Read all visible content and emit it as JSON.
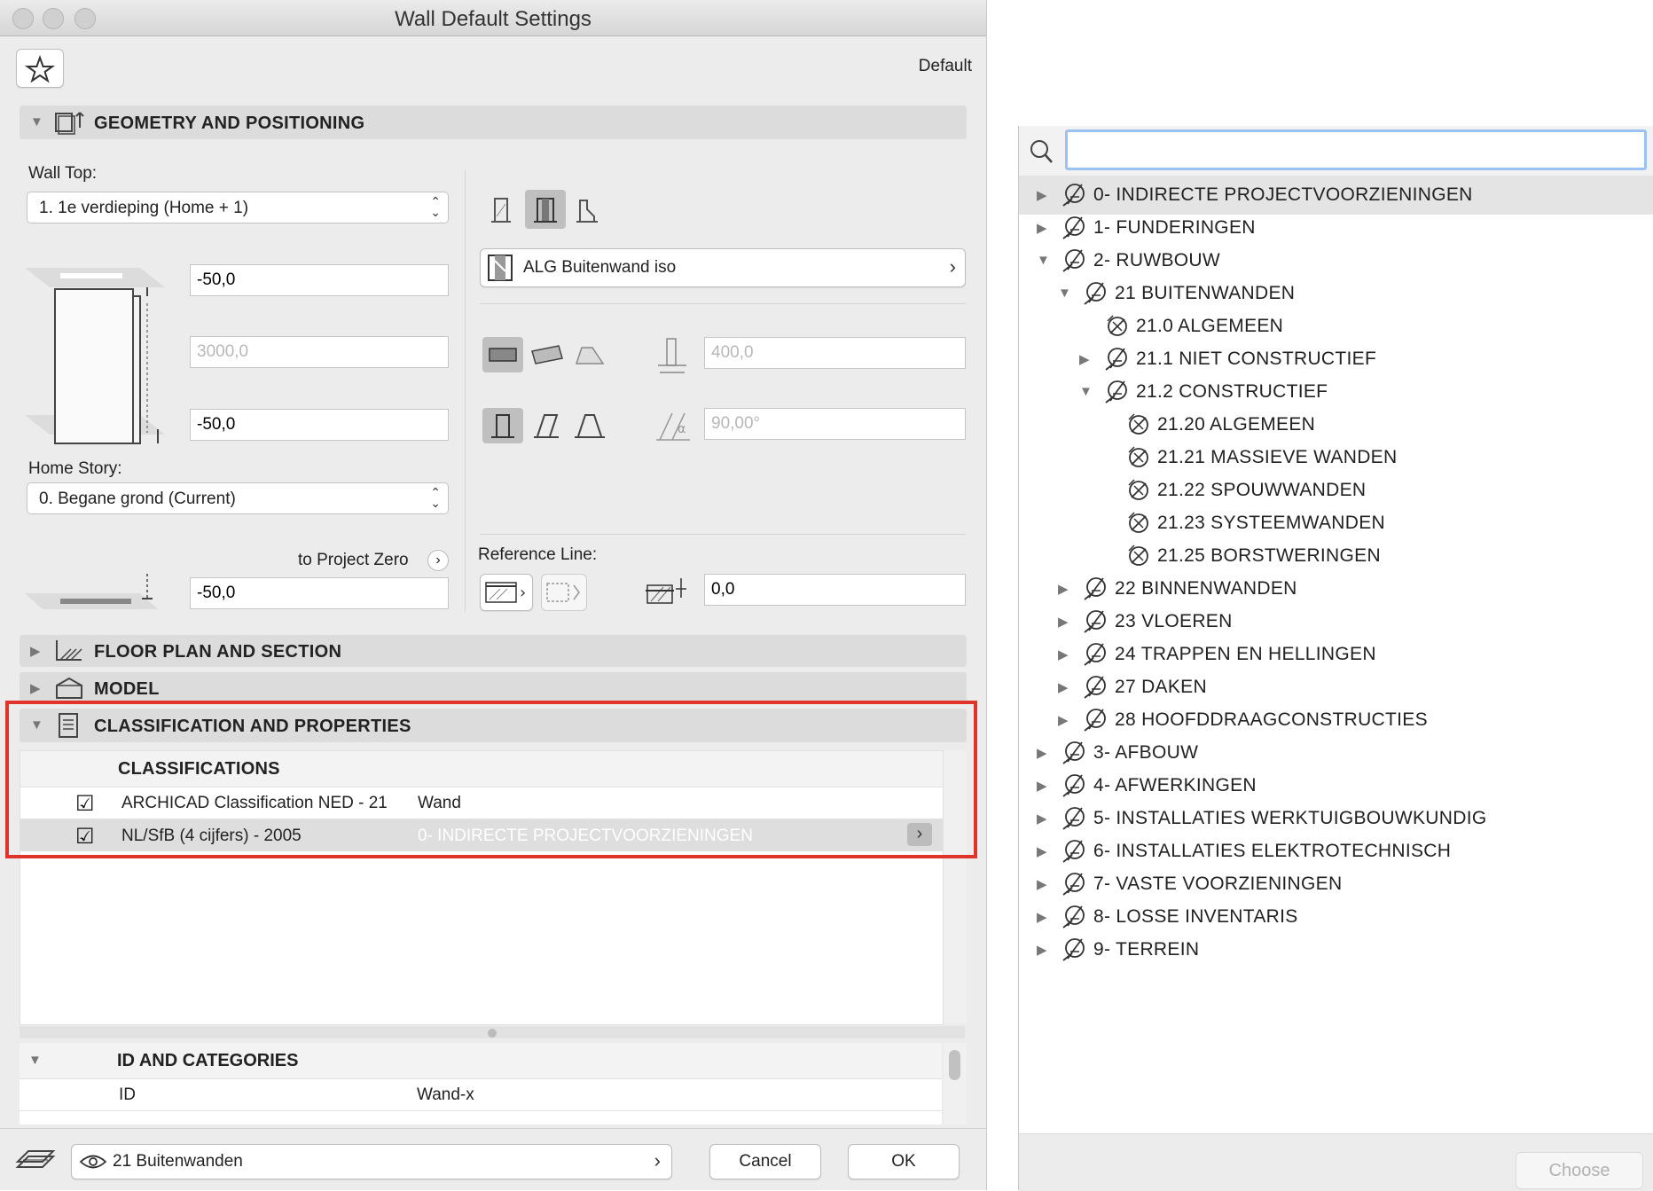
{
  "window": {
    "title": "Wall Default Settings"
  },
  "header": {
    "preset_label": "Default"
  },
  "geometry": {
    "section_title": "GEOMETRY AND POSITIONING",
    "wall_top_label": "Wall Top:",
    "wall_top_value": "1. 1e verdieping (Home + 1)",
    "top_offset": "-50,0",
    "height": "3000,0",
    "bottom_offset": "-50,0",
    "home_story_label": "Home Story:",
    "home_story_value": "0. Begane grond (Current)",
    "to_project_zero_label": "to Project Zero",
    "project_zero_value": "-50,0",
    "composite_name": "ALG Buitenwand iso",
    "thickness": "400,0",
    "angle": "90,00°",
    "reference_line_label": "Reference Line:",
    "reference_offset": "0,0"
  },
  "sections": {
    "floor_plan": "FLOOR PLAN AND SECTION",
    "model": "MODEL",
    "classification": "CLASSIFICATION AND PROPERTIES"
  },
  "classifications": {
    "header": "CLASSIFICATIONS",
    "rows": [
      {
        "system": "ARCHICAD Classification NED - 21",
        "value": "Wand",
        "checked": true
      },
      {
        "system": "NL/SfB (4 cijfers) - 2005",
        "value": "0- INDIRECTE PROJECTVOORZIENINGEN",
        "checked": true
      }
    ]
  },
  "id_categories": {
    "header": "ID AND CATEGORIES",
    "rows": [
      {
        "name": "ID",
        "value": "Wand-x"
      }
    ]
  },
  "footer": {
    "layer": "21 Buitenwanden",
    "cancel_label": "Cancel",
    "ok_label": "OK"
  },
  "chooser": {
    "search_placeholder": "",
    "items": [
      {
        "label": "0- INDIRECTE PROJECTVOORZIENINGEN",
        "level": 0,
        "state": "collapsed",
        "selected": true
      },
      {
        "label": "1- FUNDERINGEN",
        "level": 0,
        "state": "collapsed"
      },
      {
        "label": "2- RUWBOUW",
        "level": 0,
        "state": "expanded"
      },
      {
        "label": "21 BUITENWANDEN",
        "level": 1,
        "state": "expanded"
      },
      {
        "label": "21.0 ALGEMEEN",
        "level": 2,
        "state": "leaf"
      },
      {
        "label": "21.1 NIET CONSTRUCTIEF",
        "level": 2,
        "state": "collapsed"
      },
      {
        "label": "21.2 CONSTRUCTIEF",
        "level": 2,
        "state": "expanded"
      },
      {
        "label": "21.20 ALGEMEEN",
        "level": 3,
        "state": "leaf"
      },
      {
        "label": "21.21 MASSIEVE WANDEN",
        "level": 3,
        "state": "leaf"
      },
      {
        "label": "21.22 SPOUWWANDEN",
        "level": 3,
        "state": "leaf"
      },
      {
        "label": "21.23 SYSTEEMWANDEN",
        "level": 3,
        "state": "leaf"
      },
      {
        "label": "21.25 BORSTWERINGEN",
        "level": 3,
        "state": "leaf"
      },
      {
        "label": "22 BINNENWANDEN",
        "level": 1,
        "state": "collapsed"
      },
      {
        "label": "23 VLOEREN",
        "level": 1,
        "state": "collapsed"
      },
      {
        "label": "24 TRAPPEN EN HELLINGEN",
        "level": 1,
        "state": "collapsed"
      },
      {
        "label": "27 DAKEN",
        "level": 1,
        "state": "collapsed"
      },
      {
        "label": "28 HOOFDDRAAGCONSTRUCTIES",
        "level": 1,
        "state": "collapsed"
      },
      {
        "label": "3- AFBOUW",
        "level": 0,
        "state": "collapsed"
      },
      {
        "label": "4- AFWERKINGEN",
        "level": 0,
        "state": "collapsed"
      },
      {
        "label": "5- INSTALLATIES WERKTUIGBOUWKUNDIG",
        "level": 0,
        "state": "collapsed"
      },
      {
        "label": "6- INSTALLATIES ELEKTROTECHNISCH",
        "level": 0,
        "state": "collapsed"
      },
      {
        "label": "7- VASTE VOORZIENINGEN",
        "level": 0,
        "state": "collapsed"
      },
      {
        "label": "8- LOSSE INVENTARIS",
        "level": 0,
        "state": "collapsed"
      },
      {
        "label": "9- TERREIN",
        "level": 0,
        "state": "collapsed"
      }
    ],
    "choose_label": "Choose"
  },
  "colors": {
    "highlight_border": "#e0342b",
    "selection_row": "#dedede",
    "accent_focus": "#9cc2f2"
  }
}
